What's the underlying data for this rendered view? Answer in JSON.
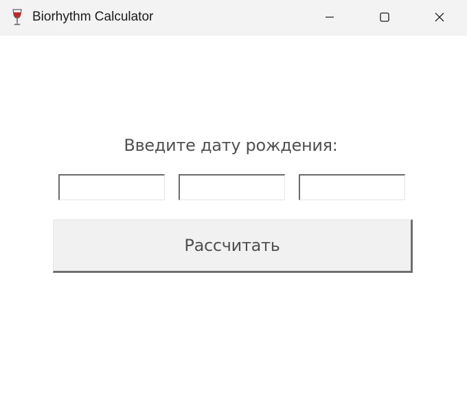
{
  "window": {
    "title": "Biorhythm Calculator",
    "icon": "wine-glass-icon",
    "controls": {
      "minimize_icon": "minimize-icon",
      "maximize_icon": "maximize-icon",
      "close_icon": "close-icon"
    }
  },
  "form": {
    "prompt": "Введите дату рождения:",
    "fields": [
      {
        "value": "",
        "placeholder": ""
      },
      {
        "value": "",
        "placeholder": ""
      },
      {
        "value": "",
        "placeholder": ""
      }
    ],
    "calculate_label": "Рассчитать"
  },
  "colors": {
    "titlebar_bg": "#f3f3f3",
    "content_bg": "#ffffff",
    "button_bg": "#f1f1f1",
    "text": "#505050",
    "icon_red": "#c0282d"
  }
}
